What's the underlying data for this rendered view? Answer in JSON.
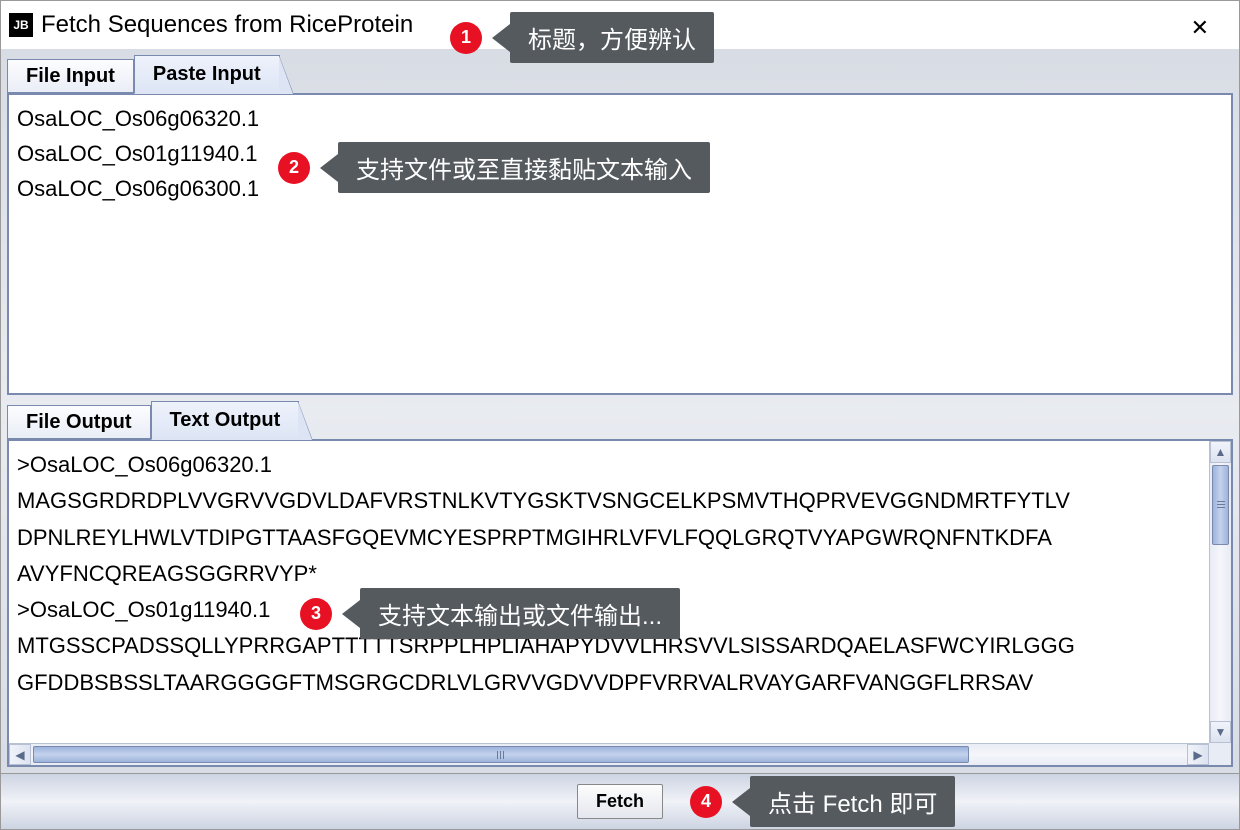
{
  "window": {
    "app_icon_text": "JB",
    "title": "Fetch Sequences from RiceProtein",
    "close_label": "✕"
  },
  "input": {
    "tabs": {
      "file": "File Input",
      "paste": "Paste Input"
    },
    "active_tab": "paste",
    "text": "OsaLOC_Os06g06320.1\nOsaLOC_Os01g11940.1\nOsaLOC_Os06g06300.1"
  },
  "output": {
    "tabs": {
      "file": "File Output",
      "text": "Text Output"
    },
    "active_tab": "text",
    "text": ">OsaLOC_Os06g06320.1\nMAGSGRDRDPLVVGRVVGDVLDAFVRSTNLKVTYGSKTVSNGCELKPSMVTHQPRVEVGGNDMRTFYTLV\nDPNLREYLHWLVTDIPGTTAASFGQEVMCYESPRPTMGIHRLVFVLFQQLGRQTVYAPGWRQNFNTKDFA\nAVYFNCQREAGSGGRRVYP*\n>OsaLOC_Os01g11940.1\nMTGSSCPADSSQLLYPRRGAPTTTTTSRPPLHPLIAHAPYDVVLHRSVVLSISSARDQAELASFWCYIRLGGG\nGFDDBSBSSLTAARGGGGFTMSGRGCDRLVLGRVVGDVVDPFVRRVALRVAYGARFVANGGFLRRSAV"
  },
  "buttons": {
    "fetch": "Fetch"
  },
  "callouts": {
    "c1": {
      "num": "1",
      "text": "标题，方便辨认"
    },
    "c2": {
      "num": "2",
      "text": "支持文件或至直接黏贴文本输入"
    },
    "c3": {
      "num": "3",
      "text": "支持文本输出或文件输出..."
    },
    "c4": {
      "num": "4",
      "text": "点击 Fetch 即可"
    }
  }
}
